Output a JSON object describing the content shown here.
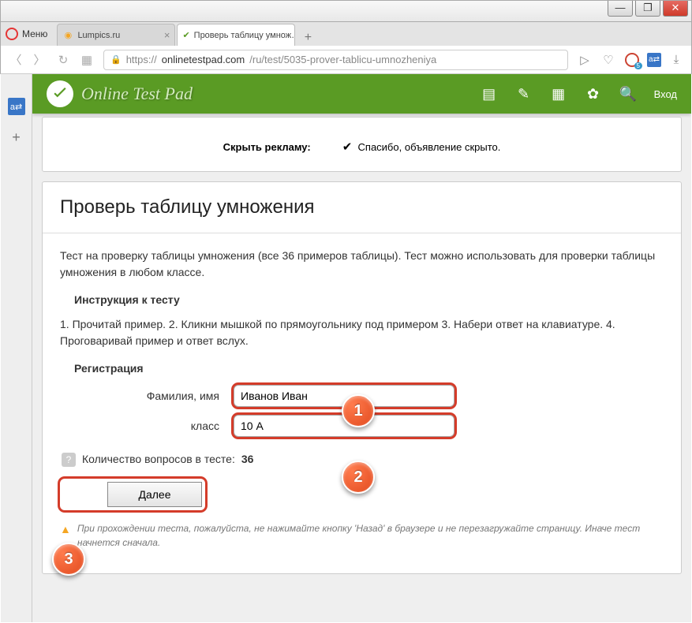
{
  "window": {
    "minimize": "—",
    "maximize": "❐",
    "close": "✕"
  },
  "browser": {
    "menu": "Меню",
    "tabs": [
      {
        "title": "Lumpics.ru",
        "favColor": "#f5a623"
      },
      {
        "title": "Проверь таблицу умнож…",
        "favColor": "#5a9b24"
      }
    ],
    "url_prefix": "https://",
    "url_domain": "onlinetestpad.com",
    "url_path": "/ru/test/5035-prover-tablicu-umnozheniya",
    "badge_count": "5"
  },
  "site": {
    "title": "Online Test Pad",
    "login": "Вход"
  },
  "ad": {
    "close_link": "",
    "hide_label": "Скрыть рекламу:",
    "thanks": "Спасибо, объявление скрыто."
  },
  "page": {
    "heading": "Проверь таблицу умножения",
    "desc": "Тест на проверку таблицы умножения (все 36 примеров таблицы). Тест можно использовать для проверки таблицы умножения в любом классе.",
    "instr_title": "Инструкция к тесту",
    "instr_text": "1. Прочитай пример. 2. Кликни мышкой по прямоугольнику под примером 3. Набери ответ на клавиатуре. 4. Проговаривай пример и ответ вслух.",
    "reg_title": "Регистрация",
    "label_name": "Фамилия, имя",
    "value_name": "Иванов Иван",
    "label_class": "класс",
    "value_class": "10 А",
    "qcount_label": "Количество вопросов в тесте:",
    "qcount_value": "36",
    "next": "Далее",
    "warning": "При прохождении теста, пожалуйста, не нажимайте кнопку 'Назад' в браузере и не перезагружайте страницу. Иначе тест начнется сначала."
  },
  "callouts": {
    "c1": "1",
    "c2": "2",
    "c3": "3"
  }
}
